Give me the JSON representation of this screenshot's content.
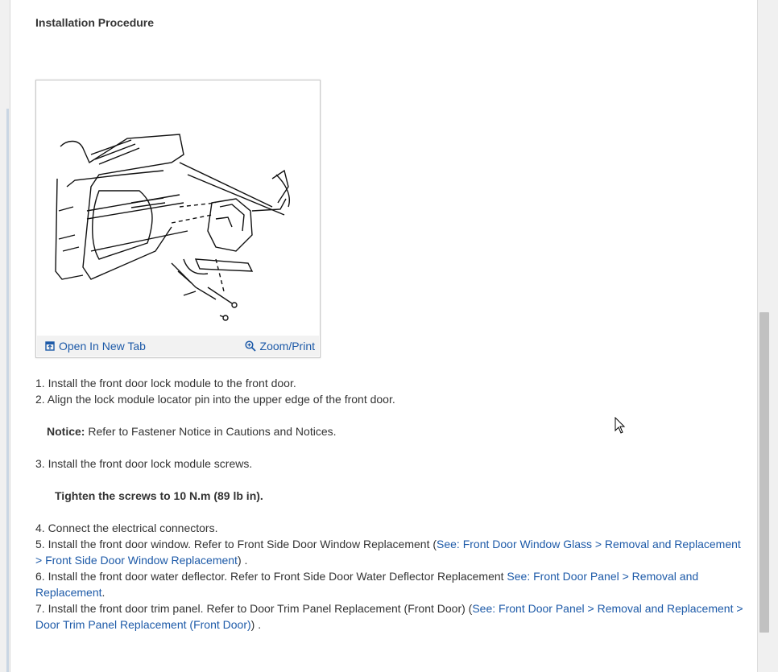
{
  "heading": "Installation Procedure",
  "figure": {
    "open_label": "Open In New Tab",
    "zoom_label": "Zoom/Print",
    "open_icon": "open-new-tab-icon",
    "zoom_icon": "magnifier-icon"
  },
  "steps": {
    "s1": "1. Install the front door lock module to the front door.",
    "s2": "2. Align the lock module locator pin into the upper edge of the front door.",
    "notice_label": "Notice:",
    "notice_text": " Refer to Fastener Notice in Cautions and Notices.",
    "s3": "3. Install the front door lock module screws.",
    "tighten": "Tighten the screws to 10 N.m (89 lb in).",
    "s4": "4. Connect the electrical connectors.",
    "s5_text": "5. Install the front door window. Refer to Front Side Door Window Replacement (",
    "s5_link": "See: Front Door Window Glass > Removal and Replacement > Front Side Door Window Replacement",
    "s5_end": ") .",
    "s6_text": "6. Install the front door water deflector. Refer to Front Side Door Water Deflector Replacement ",
    "s6_link": "See: Front Door Panel > Removal and Replacement",
    "s6_end": ".",
    "s7_text": "7. Install the front door trim panel. Refer to Door Trim Panel Replacement (Front Door) (",
    "s7_link": "See: Front Door Panel > Removal and Replacement > Door Trim Panel Replacement (Front Door)",
    "s7_end": ") ."
  },
  "colors": {
    "link": "#1d5aa8",
    "text": "#333333"
  }
}
